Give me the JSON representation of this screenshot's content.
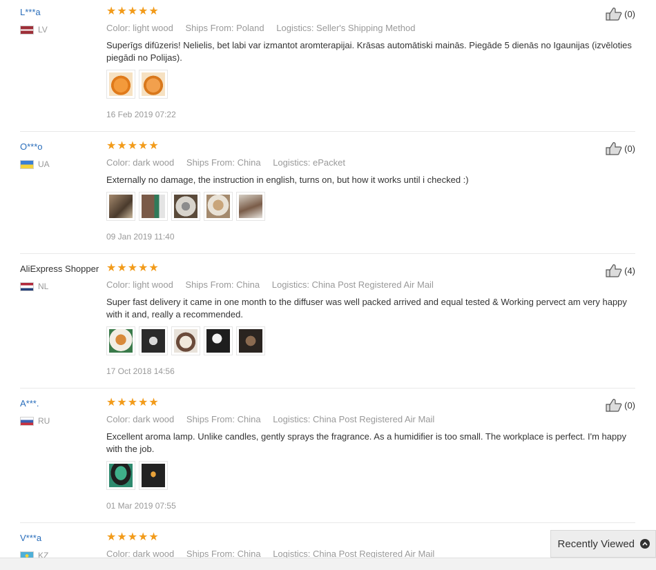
{
  "reviews": [
    {
      "user": "L***a",
      "country": "LV",
      "flag": "lv",
      "rating": 5,
      "color": "Color: light wood",
      "ships_from": "Ships From: Poland",
      "logistics": "Logistics: Seller's Shipping Method",
      "text": "Superīgs difūzeris! Nelielis, bet labi var izmantot aromterapijai. Krāsas automātiski mainās. Piegāde 5 dienās no Igaunijas (izvēloties piegādi no Polijas).",
      "photo_count": 2,
      "date": "16 Feb 2019 07:22",
      "likes": "(0)"
    },
    {
      "user": "O***o",
      "country": "UA",
      "flag": "ua",
      "rating": 5,
      "color": "Color: dark wood",
      "ships_from": "Ships From: China",
      "logistics": "Logistics: ePacket",
      "text": "Externally no damage, the instruction in english, turns on, but how it works until i checked :)",
      "photo_count": 5,
      "date": "09 Jan 2019 11:40",
      "likes": "(0)"
    },
    {
      "user": "AliExpress Shopper",
      "country": "NL",
      "flag": "nl",
      "rating": 5,
      "color": "Color: light wood",
      "ships_from": "Ships From: China",
      "logistics": "Logistics: China Post Registered Air Mail",
      "text": "Super fast delivery it came in one month to the diffuser was well packed arrived and equal tested & Working pervect am very happy with it and, really a recommended.",
      "photo_count": 5,
      "date": "17 Oct 2018 14:56",
      "likes": "(4)"
    },
    {
      "user": "A***.",
      "country": "RU",
      "flag": "ru",
      "rating": 5,
      "color": "Color: dark wood",
      "ships_from": "Ships From: China",
      "logistics": "Logistics: China Post Registered Air Mail",
      "text": "Excellent aroma lamp. Unlike candles, gently sprays the fragrance. As a humidifier is too small. The workplace is perfect. I'm happy with the job.",
      "photo_count": 2,
      "date": "01 Mar 2019 07:55",
      "likes": "(0)"
    },
    {
      "user": "V***a",
      "country": "KZ",
      "flag": "kz",
      "rating": 5,
      "color": "Color: dark wood",
      "ships_from": "Ships From: China",
      "logistics": "Logistics: China Post Registered Air Mail",
      "text": "",
      "photo_count": 0,
      "date": "",
      "likes": ""
    }
  ],
  "recently_viewed": {
    "label": "Recently Viewed",
    "icon": "chevron-up-icon"
  },
  "colors": {
    "star": "#f29b1a",
    "username": "#2a6ebb",
    "muted": "#999999"
  }
}
